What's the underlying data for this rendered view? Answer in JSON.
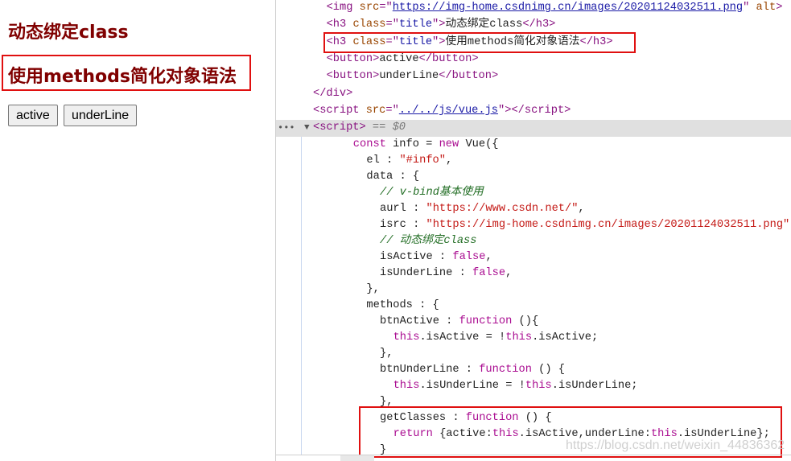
{
  "page": {
    "headings": [
      "动态绑定class",
      "使用methods简化对象语法"
    ],
    "buttons": [
      "active",
      "underLine"
    ]
  },
  "devtools": {
    "selected_node_ellipsis": "•••",
    "expand_arrow": "▼",
    "lines": [
      {
        "indent": 1,
        "tokens": [
          {
            "t": "<img ",
            "c": "tag"
          },
          {
            "t": "src",
            "c": "attr"
          },
          {
            "t": "=\"",
            "c": "tag"
          },
          {
            "t": "https://img-home.csdnimg.cn/images/20201124032511.png",
            "c": "link"
          },
          {
            "t": "\" ",
            "c": "tag"
          },
          {
            "t": "alt",
            "c": "attr"
          },
          {
            "t": ">",
            "c": "tag"
          }
        ]
      },
      {
        "indent": 1,
        "tokens": [
          {
            "t": "<h3 ",
            "c": "tag"
          },
          {
            "t": "class",
            "c": "attr"
          },
          {
            "t": "=\"",
            "c": "tag"
          },
          {
            "t": "title",
            "c": "val"
          },
          {
            "t": "\">",
            "c": "tag"
          },
          {
            "t": "动态绑定class",
            "c": "txt"
          },
          {
            "t": "</h3>",
            "c": "tag"
          }
        ]
      },
      {
        "indent": 1,
        "tokens": [
          {
            "t": "<h3 ",
            "c": "tag"
          },
          {
            "t": "class",
            "c": "attr"
          },
          {
            "t": "=\"",
            "c": "tag"
          },
          {
            "t": "title",
            "c": "val"
          },
          {
            "t": "\">",
            "c": "tag"
          },
          {
            "t": "使用methods简化对象语法",
            "c": "txt"
          },
          {
            "t": "</h3>",
            "c": "tag"
          }
        ]
      },
      {
        "indent": 1,
        "tokens": [
          {
            "t": "<button>",
            "c": "tag"
          },
          {
            "t": "active",
            "c": "txt"
          },
          {
            "t": "</button>",
            "c": "tag"
          }
        ]
      },
      {
        "indent": 1,
        "tokens": [
          {
            "t": "<button>",
            "c": "tag"
          },
          {
            "t": "underLine",
            "c": "txt"
          },
          {
            "t": "</button>",
            "c": "tag"
          }
        ]
      },
      {
        "indent": 0,
        "tokens": [
          {
            "t": "</div>",
            "c": "tag"
          }
        ]
      },
      {
        "indent": 0,
        "tokens": [
          {
            "t": "<script ",
            "c": "tag"
          },
          {
            "t": "src",
            "c": "attr"
          },
          {
            "t": "=\"",
            "c": "tag"
          },
          {
            "t": "../../js/vue.js",
            "c": "link"
          },
          {
            "t": "\"></script>",
            "c": "tag"
          }
        ]
      },
      {
        "indent": 0,
        "tokens": [
          {
            "t": "<script>",
            "c": "tag"
          },
          {
            "t": " == ",
            "c": "gray"
          },
          {
            "t": "$0",
            "c": "gray"
          }
        ]
      },
      {
        "indent": 3,
        "tokens": [
          {
            "t": "const ",
            "c": "kw"
          },
          {
            "t": "info = ",
            "c": "txt"
          },
          {
            "t": "new ",
            "c": "kw"
          },
          {
            "t": "Vue({",
            "c": "txt"
          }
        ]
      },
      {
        "indent": 4,
        "tokens": [
          {
            "t": "el : ",
            "c": "txt"
          },
          {
            "t": "\"#info\"",
            "c": "str"
          },
          {
            "t": ",",
            "c": "txt"
          }
        ]
      },
      {
        "indent": 4,
        "tokens": [
          {
            "t": "data : {",
            "c": "txt"
          }
        ]
      },
      {
        "indent": 5,
        "tokens": [
          {
            "t": "// v-bind基本使用",
            "c": "cm"
          }
        ]
      },
      {
        "indent": 5,
        "tokens": [
          {
            "t": "aurl : ",
            "c": "txt"
          },
          {
            "t": "\"https://www.csdn.net/\"",
            "c": "str"
          },
          {
            "t": ",",
            "c": "txt"
          }
        ]
      },
      {
        "indent": 5,
        "tokens": [
          {
            "t": "isrc : ",
            "c": "txt"
          },
          {
            "t": "\"https://img-home.csdnimg.cn/images/20201124032511.png\"",
            "c": "str"
          }
        ]
      },
      {
        "indent": 5,
        "tokens": [
          {
            "t": "// 动态绑定class",
            "c": "cm"
          }
        ]
      },
      {
        "indent": 5,
        "tokens": [
          {
            "t": "isActive : ",
            "c": "txt"
          },
          {
            "t": "false",
            "c": "kw"
          },
          {
            "t": ",",
            "c": "txt"
          }
        ]
      },
      {
        "indent": 5,
        "tokens": [
          {
            "t": "isUnderLine : ",
            "c": "txt"
          },
          {
            "t": "false",
            "c": "kw"
          },
          {
            "t": ",",
            "c": "txt"
          }
        ]
      },
      {
        "indent": 4,
        "tokens": [
          {
            "t": "},",
            "c": "txt"
          }
        ]
      },
      {
        "indent": 4,
        "tokens": [
          {
            "t": "methods : {",
            "c": "txt"
          }
        ]
      },
      {
        "indent": 5,
        "tokens": [
          {
            "t": "btnActive : ",
            "c": "txt"
          },
          {
            "t": "function ",
            "c": "kw"
          },
          {
            "t": "(){",
            "c": "txt"
          }
        ]
      },
      {
        "indent": 6,
        "tokens": [
          {
            "t": "this",
            "c": "kw"
          },
          {
            "t": ".isActive = !",
            "c": "txt"
          },
          {
            "t": "this",
            "c": "kw"
          },
          {
            "t": ".isActive;",
            "c": "txt"
          }
        ]
      },
      {
        "indent": 5,
        "tokens": [
          {
            "t": "},",
            "c": "txt"
          }
        ]
      },
      {
        "indent": 5,
        "tokens": [
          {
            "t": "btnUnderLine : ",
            "c": "txt"
          },
          {
            "t": "function ",
            "c": "kw"
          },
          {
            "t": "() {",
            "c": "txt"
          }
        ]
      },
      {
        "indent": 6,
        "tokens": [
          {
            "t": "this",
            "c": "kw"
          },
          {
            "t": ".isUnderLine = !",
            "c": "txt"
          },
          {
            "t": "this",
            "c": "kw"
          },
          {
            "t": ".isUnderLine;",
            "c": "txt"
          }
        ]
      },
      {
        "indent": 5,
        "tokens": [
          {
            "t": "},",
            "c": "txt"
          }
        ]
      },
      {
        "indent": 5,
        "tokens": [
          {
            "t": "getClasses : ",
            "c": "txt"
          },
          {
            "t": "function ",
            "c": "kw"
          },
          {
            "t": "() {",
            "c": "txt"
          }
        ]
      },
      {
        "indent": 6,
        "tokens": [
          {
            "t": "return ",
            "c": "kw"
          },
          {
            "t": "{active:",
            "c": "txt"
          },
          {
            "t": "this",
            "c": "kw"
          },
          {
            "t": ".isActive,underLine:",
            "c": "txt"
          },
          {
            "t": "this",
            "c": "kw"
          },
          {
            "t": ".isUnderLine};",
            "c": "txt"
          }
        ]
      },
      {
        "indent": 5,
        "tokens": [
          {
            "t": "}",
            "c": "txt"
          }
        ]
      }
    ]
  },
  "watermark": "https://blog.csdn.net/weixin_44836362",
  "colors": {
    "heading": "#800000",
    "highlight_box": "#e01010",
    "tag": "#881280",
    "keyword": "#aa0d91",
    "string": "#c41a16",
    "comment": "#236e25"
  }
}
